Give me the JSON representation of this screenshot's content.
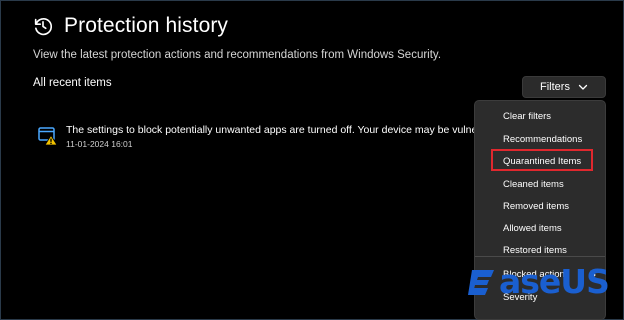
{
  "page": {
    "title": "Protection history",
    "subtitle": "View the latest protection actions and recommendations from Windows Security.",
    "section_label": "All recent items"
  },
  "filters": {
    "button_label": "Filters",
    "menu": [
      "Clear filters",
      "Recommendations",
      "Quarantined Items",
      "Cleaned items",
      "Removed items",
      "Allowed items",
      "Restored items",
      "Blocked actions",
      "Severity"
    ],
    "highlighted_item": "Quarantined Items"
  },
  "items": [
    {
      "text": "The settings to block potentially unwanted apps are turned off. Your device may be vulnerable.",
      "timestamp": "11-01-2024 16:01",
      "icon": "shield-warning-icon"
    }
  ],
  "watermark": {
    "text": "aseUS"
  },
  "colors": {
    "background": "#000000",
    "menu": "#2c2c2c",
    "highlight": "#e0282e",
    "warning": "#f2c200",
    "accent": "#1a5fd0"
  }
}
